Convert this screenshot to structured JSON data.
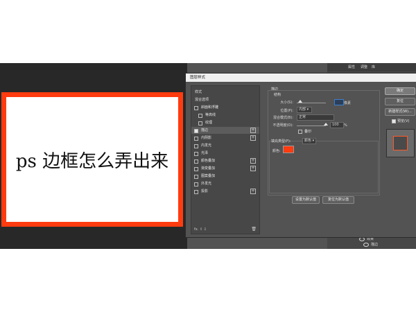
{
  "document": {
    "text": "ps 边框怎么弄出来",
    "border_color": "#ff3b0f"
  },
  "right_panel": {
    "tabs": [
      "属性",
      "调整",
      "库"
    ],
    "layers": [
      "效果",
      "描边"
    ]
  },
  "dialog": {
    "title": "图层样式",
    "style_list_header": "样式",
    "blend_options": "混合选项",
    "items": [
      {
        "label": "斜面和浮雕",
        "checked": false,
        "plus": false
      },
      {
        "label": "等高线",
        "checked": false,
        "plus": false
      },
      {
        "label": "纹理",
        "checked": false,
        "plus": false
      },
      {
        "label": "描边",
        "checked": true,
        "plus": true
      },
      {
        "label": "内阴影",
        "checked": false,
        "plus": true
      },
      {
        "label": "内发光",
        "checked": false,
        "plus": false
      },
      {
        "label": "光泽",
        "checked": false,
        "plus": false
      },
      {
        "label": "颜色叠加",
        "checked": false,
        "plus": true
      },
      {
        "label": "渐变叠加",
        "checked": false,
        "plus": true
      },
      {
        "label": "图案叠加",
        "checked": false,
        "plus": false
      },
      {
        "label": "外发光",
        "checked": false,
        "plus": false
      },
      {
        "label": "投影",
        "checked": false,
        "plus": true
      }
    ],
    "footer_fx": "fx. ⇧ ⇩",
    "stroke": {
      "section_title": "描边",
      "structure_title": "结构",
      "size_label": "大小(S):",
      "size_unit": "像素",
      "position_label": "位置(P):",
      "position_value": "内部",
      "blend_label": "混合模式(B):",
      "blend_value": "正常",
      "opacity_label": "不透明度(O):",
      "opacity_value": "100",
      "opacity_unit": "%",
      "overprint_label": "叠印",
      "fill_type_label": "填充类型(F):",
      "fill_type_value": "颜色",
      "color_label": "颜色:",
      "color_value": "#ff3b0f",
      "set_default_button": "设置为默认值",
      "reset_default_button": "复位为默认值"
    },
    "buttons": {
      "ok": "确定",
      "cancel": "复位",
      "new_style": "新建样式(W)...",
      "preview_label": "预览(V)"
    }
  }
}
